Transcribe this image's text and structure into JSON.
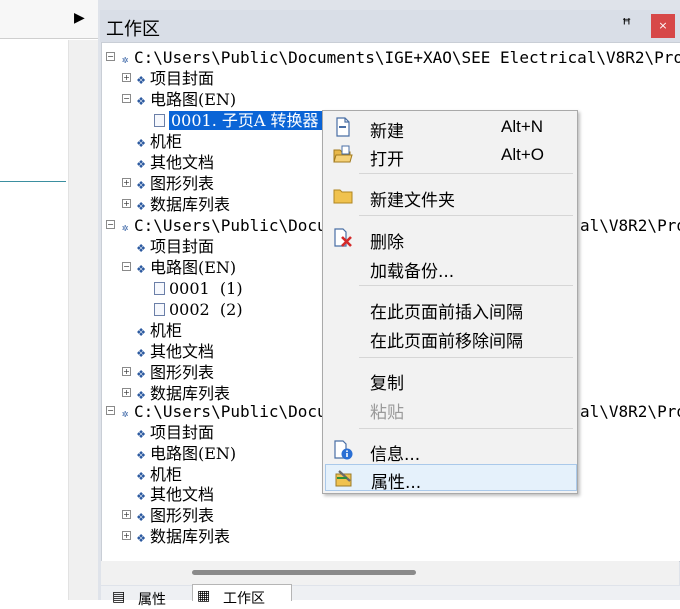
{
  "left_panel": {
    "arrow": "▶"
  },
  "workspace": {
    "title": "工作区",
    "pin": "ꟸ",
    "close": "×"
  },
  "tree": {
    "project1": {
      "path": "C:\\Users\\Public\\Documents\\IGE+XAO\\SEE Electrical\\V8R2\\Pro",
      "items": [
        "项目封面",
        "电路图(EN)",
        "机柜",
        "其他文档",
        "图形列表",
        "数据库列表"
      ],
      "selected_page": "0001. 子页A 转换器"
    },
    "project2": {
      "path_start": "C:\\Users\\Public\\Docu",
      "path_end": "al\\V8R2\\Pro",
      "items": [
        "项目封面",
        "电路图(EN)",
        "机柜",
        "其他文档",
        "图形列表",
        "数据库列表"
      ],
      "pages": [
        "0001  (1)",
        "0002  (2)"
      ]
    },
    "project3": {
      "path_start": "C:\\Users\\Public\\Docu",
      "path_end": "al\\V8R2\\Pro",
      "items": [
        "项目封面",
        "电路图(EN)",
        "机柜",
        "其他文档",
        "图形列表",
        "数据库列表"
      ]
    }
  },
  "context_menu": {
    "new": "新建",
    "new_shortcut": "Alt+N",
    "open": "打开",
    "open_shortcut": "Alt+O",
    "new_folder": "新建文件夹",
    "delete": "删除",
    "load_backup": "加载备份...",
    "insert_gap": "在此页面前插入间隔",
    "remove_gap": "在此页面前移除间隔",
    "copy": "复制",
    "paste": "粘贴",
    "info": "信息...",
    "properties": "属性..."
  },
  "tabs": {
    "properties": "属性",
    "workspace": "工作区"
  }
}
